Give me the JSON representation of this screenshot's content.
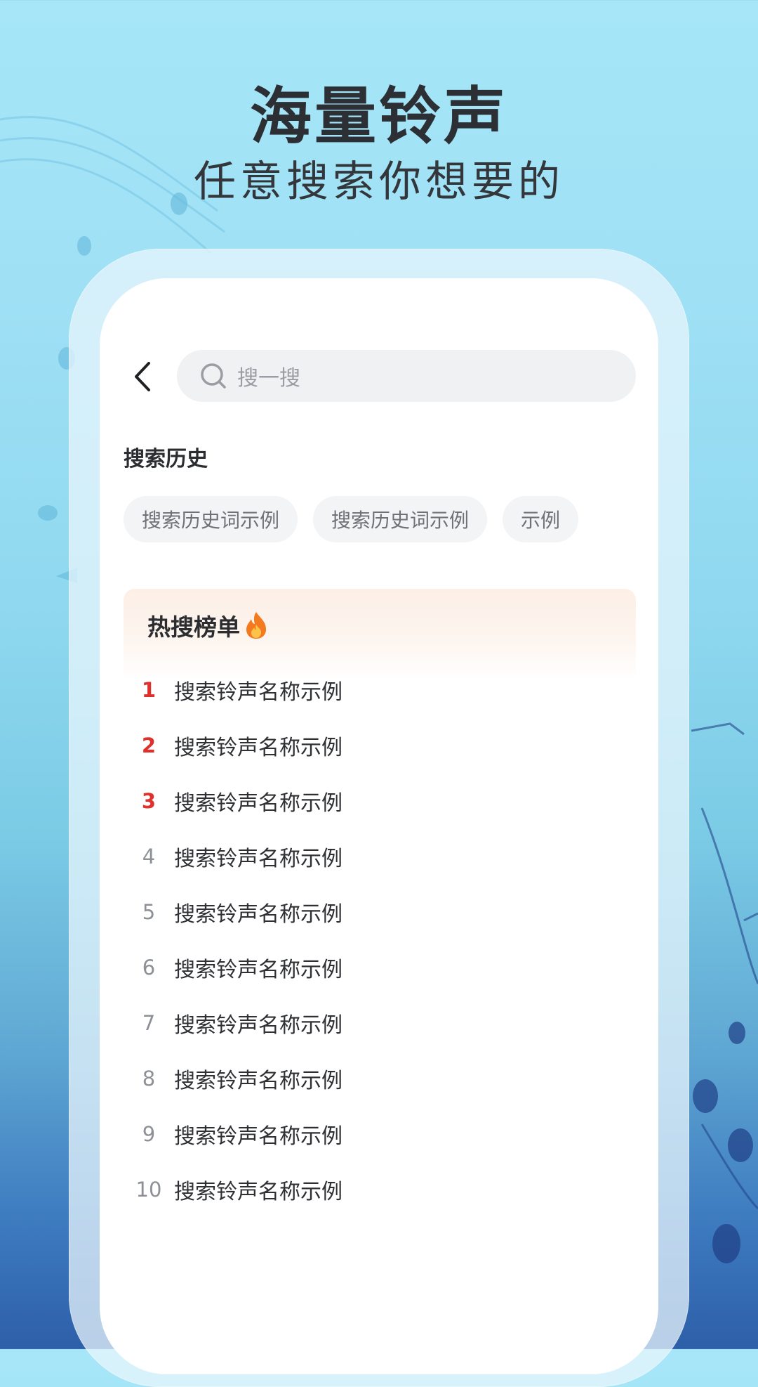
{
  "promo": {
    "title": "海量铃声",
    "subtitle": "任意搜索你想要的"
  },
  "search": {
    "placeholder": "搜一搜",
    "back_icon": "chevron-left-icon",
    "search_icon": "search-icon"
  },
  "history": {
    "label": "搜索历史",
    "chips": [
      "搜索历史词示例",
      "搜索历史词示例",
      "示例"
    ]
  },
  "hot": {
    "label": "热搜榜单",
    "icon": "fire-icon",
    "items": [
      {
        "rank": "1",
        "text": "搜索铃声名称示例"
      },
      {
        "rank": "2",
        "text": "搜索铃声名称示例"
      },
      {
        "rank": "3",
        "text": "搜索铃声名称示例"
      },
      {
        "rank": "4",
        "text": "搜索铃声名称示例"
      },
      {
        "rank": "5",
        "text": "搜索铃声名称示例"
      },
      {
        "rank": "6",
        "text": "搜索铃声名称示例"
      },
      {
        "rank": "7",
        "text": "搜索铃声名称示例"
      },
      {
        "rank": "8",
        "text": "搜索铃声名称示例"
      },
      {
        "rank": "9",
        "text": "搜索铃声名称示例"
      },
      {
        "rank": "10",
        "text": "搜索铃声名称示例"
      }
    ]
  },
  "colors": {
    "top_rank": "#e0302b",
    "rank": "#8d9096",
    "background_top": "#a6e6f8",
    "background_bottom": "#2d5fa9"
  }
}
